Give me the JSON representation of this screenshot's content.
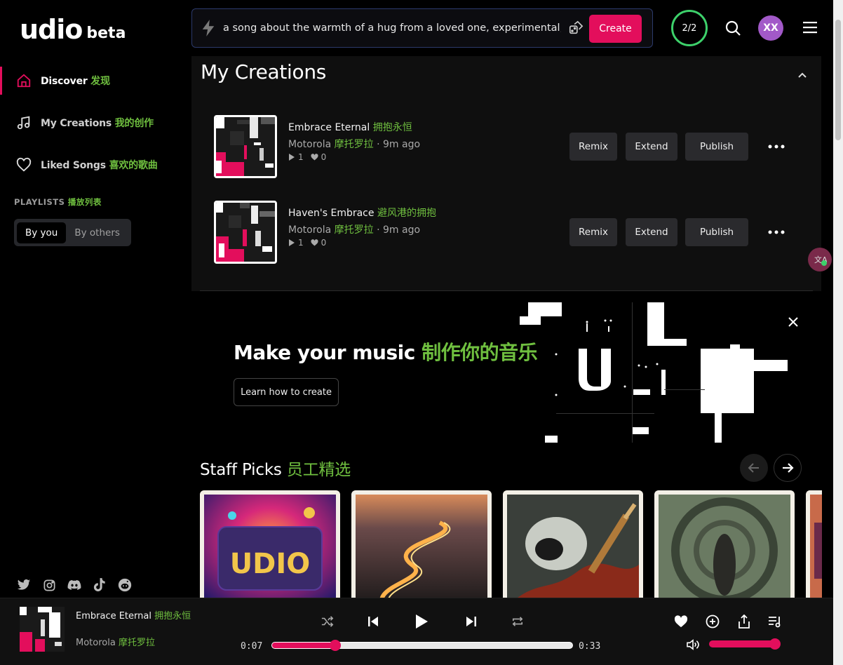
{
  "brand": {
    "name": "udio",
    "tag": "beta"
  },
  "sidebar": {
    "nav": [
      {
        "label": "Discover",
        "cn": "发现",
        "icon": "home-icon",
        "active": true
      },
      {
        "label": "My Creations",
        "cn": "我的创作",
        "icon": "music-note-icon",
        "active": false
      },
      {
        "label": "Liked Songs",
        "cn": "喜欢的歌曲",
        "icon": "heart-icon",
        "active": false
      }
    ],
    "playlists_label": "PLAYLISTS",
    "playlists_cn": "播放列表",
    "segment": {
      "by_you": "By you",
      "by_others": "By others"
    },
    "socials": [
      "twitter-icon",
      "instagram-icon",
      "discord-icon",
      "tiktok-icon",
      "reddit-icon"
    ]
  },
  "topbar": {
    "prompt": "a song about the warmth of a hug from a loved one, experimental, melancholic",
    "create_label": "Create",
    "credits": "2/2",
    "avatar_initials": "XX"
  },
  "creations": {
    "title": "My Creations",
    "tracks": [
      {
        "title": "Embrace Eternal",
        "title_cn": "拥抱永恒",
        "artist": "Motorola",
        "artist_cn": "摩托罗拉",
        "age": "9m ago",
        "plays": "1",
        "likes": "0"
      },
      {
        "title": "Haven's Embrace",
        "title_cn": "避风港的拥抱",
        "artist": "Motorola",
        "artist_cn": "摩托罗拉",
        "age": "9m ago",
        "plays": "1",
        "likes": "0"
      }
    ],
    "buttons": {
      "remix": "Remix",
      "extend": "Extend",
      "publish": "Publish"
    }
  },
  "banner": {
    "title": "Make your music",
    "title_cn": "制作你的音乐",
    "cta": "Learn how to create"
  },
  "staff_picks": {
    "title": "Staff Picks",
    "title_cn": "员工精选"
  },
  "player": {
    "title": "Embrace Eternal",
    "title_cn": "拥抱永恒",
    "artist": "Motorola",
    "artist_cn": "摩托罗拉",
    "elapsed": "0:07",
    "duration": "0:33",
    "progress": 0.21,
    "volume": 1.0
  },
  "colors": {
    "accent": "#e30e5c",
    "cn_text": "#6fbf3f",
    "credits_ring": "#3dd16b",
    "avatar": "#a259c8"
  }
}
